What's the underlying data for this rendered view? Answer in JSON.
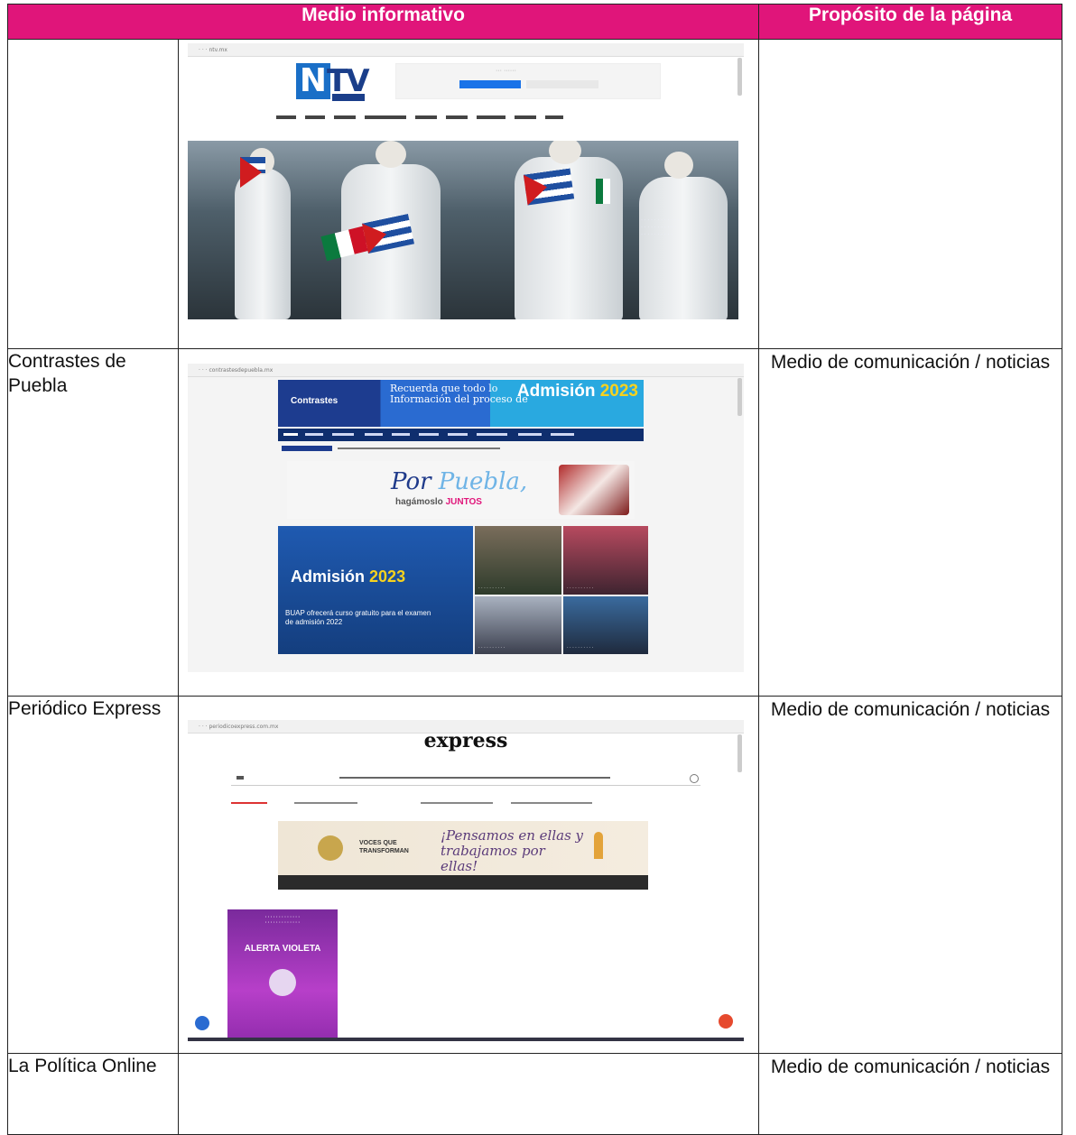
{
  "table": {
    "headers": [
      "Medio informativo",
      "Propósito de la página"
    ],
    "rows": [
      {
        "name": "",
        "purpose": "",
        "screenshot": "ntv-noticias-homepage"
      },
      {
        "name": "Contrastes de Puebla",
        "purpose": "Medio de comunicación / noticias",
        "screenshot": "contrastes-de-puebla-homepage"
      },
      {
        "name": "Periódico Express",
        "purpose": "Medio de comunicación / noticias",
        "screenshot": "periodico-express-homepage"
      },
      {
        "name": "La Política Online",
        "purpose": "Medio de comunicación / noticias",
        "screenshot": ""
      }
    ]
  },
  "screens": {
    "ntv": {
      "logo_letters": "NTV"
    },
    "contrastes": {
      "headline_top": "Recuerda que todo lo",
      "headline_top2": "Información del proceso de",
      "admision": "Admisión",
      "year": "2023",
      "banner_por": "Por ",
      "banner_puebla": "Puebla,",
      "banner_juntos_a": "hagámoslo ",
      "banner_juntos_b": "JUNTOS",
      "feature_text": "BUAP ofrecerá curso gratuito para el examen de admisión 2022"
    },
    "express": {
      "logo": "express",
      "ad_voces": "VOCES QUE TRANSFORMAN",
      "ad_script": "¡Pensamos en ellas y trabajamos por ellas!",
      "violet_title": "ALERTA VIOLETA"
    }
  },
  "colors": {
    "header_bg": "#e0157a",
    "header_text": "#ffffff",
    "border": "#222222"
  }
}
